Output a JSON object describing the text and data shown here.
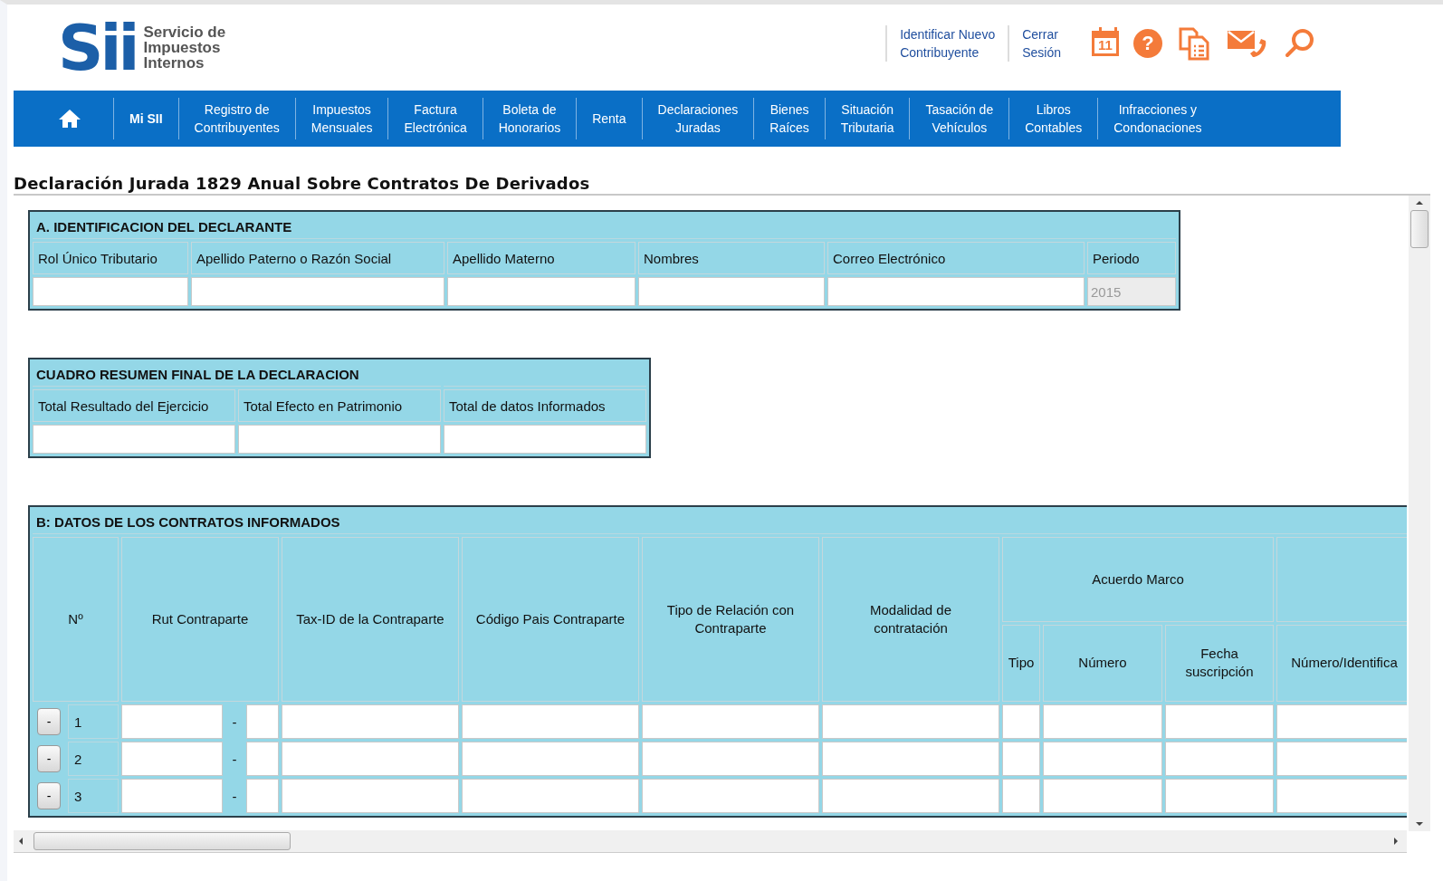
{
  "header": {
    "logo": {
      "mark": "Sii",
      "lines": [
        "Servicio de",
        "Impuestos",
        "Internos"
      ]
    },
    "links": [
      {
        "lines": [
          "Identificar Nuevo",
          "Contribuyente"
        ]
      },
      {
        "lines": [
          "Cerrar",
          "Sesión"
        ]
      }
    ],
    "icons": [
      {
        "kind": "calendar",
        "text": "11"
      },
      {
        "kind": "help",
        "text": "?"
      },
      {
        "kind": "documents"
      },
      {
        "kind": "mail-phone"
      },
      {
        "kind": "search"
      }
    ]
  },
  "nav": [
    {
      "kind": "home"
    },
    {
      "kind": "text",
      "lines": [
        "Mi SII"
      ]
    },
    {
      "kind": "text",
      "lines": [
        "Registro de",
        "Contribuyentes"
      ]
    },
    {
      "kind": "text",
      "lines": [
        "Impuestos",
        "Mensuales"
      ]
    },
    {
      "kind": "text",
      "lines": [
        "Factura",
        "Electrónica"
      ]
    },
    {
      "kind": "text",
      "lines": [
        "Boleta de",
        "Honorarios"
      ]
    },
    {
      "kind": "text",
      "lines": [
        "Renta"
      ]
    },
    {
      "kind": "text",
      "lines": [
        "Declaraciones",
        "Juradas"
      ]
    },
    {
      "kind": "text",
      "lines": [
        "Bienes",
        "Raíces"
      ]
    },
    {
      "kind": "text",
      "lines": [
        "Situación",
        "Tributaria"
      ]
    },
    {
      "kind": "text",
      "lines": [
        "Tasación de",
        "Vehículos"
      ]
    },
    {
      "kind": "text",
      "lines": [
        "Libros",
        "Contables"
      ]
    },
    {
      "kind": "text",
      "lines": [
        "Infracciones y",
        "Condonaciones"
      ]
    }
  ],
  "title": "Declaración Jurada 1829 Anual Sobre Contratos De Derivados",
  "section_a": {
    "title": "A. IDENTIFICACION DEL DECLARANTE",
    "columns": [
      {
        "label": "Rol Único Tributario",
        "disabled": false
      },
      {
        "label": "Apellido Paterno o Razón Social",
        "disabled": false
      },
      {
        "label": "Apellido Materno",
        "disabled": false
      },
      {
        "label": "Nombres",
        "disabled": false
      },
      {
        "label": "Correo Electrónico",
        "disabled": false
      },
      {
        "label": "Periodo",
        "value": "2015",
        "disabled": true
      }
    ]
  },
  "summary": {
    "title": "CUADRO RESUMEN FINAL DE LA DECLARACION",
    "columns": [
      "Total Resultado del Ejercicio",
      "Total Efecto en Patrimonio",
      "Total de datos Informados"
    ]
  },
  "section_b": {
    "title": "B: DATOS DE LOS CONTRATOS INFORMADOS",
    "columns": [
      {
        "kind": "single",
        "lines": [
          "Nº"
        ]
      },
      {
        "kind": "single",
        "lines": [
          "Rut Contraparte"
        ]
      },
      {
        "kind": "single",
        "lines": [
          "Tax-ID de la Contraparte"
        ]
      },
      {
        "kind": "single",
        "lines": [
          "Código Pais Contraparte"
        ]
      },
      {
        "kind": "single",
        "lines": [
          "Tipo de Relación con",
          "Contraparte"
        ]
      },
      {
        "kind": "single",
        "lines": [
          "Modalidad de",
          "contratación"
        ]
      },
      {
        "kind": "group",
        "label": "Acuerdo Marco",
        "sub": [
          {
            "lines": [
              "Tipo"
            ]
          },
          {
            "lines": [
              "Número"
            ]
          },
          {
            "lines": [
              "Fecha",
              "suscripción"
            ]
          }
        ]
      },
      {
        "kind": "group",
        "sub": [
          {
            "lines": [
              "Número/Identifica"
            ]
          }
        ]
      }
    ],
    "rows": [
      {
        "remove": "-",
        "number": "1",
        "separator": "-"
      },
      {
        "remove": "-",
        "number": "2",
        "separator": "-"
      },
      {
        "remove": "-",
        "number": "3",
        "separator": "-"
      }
    ]
  }
}
